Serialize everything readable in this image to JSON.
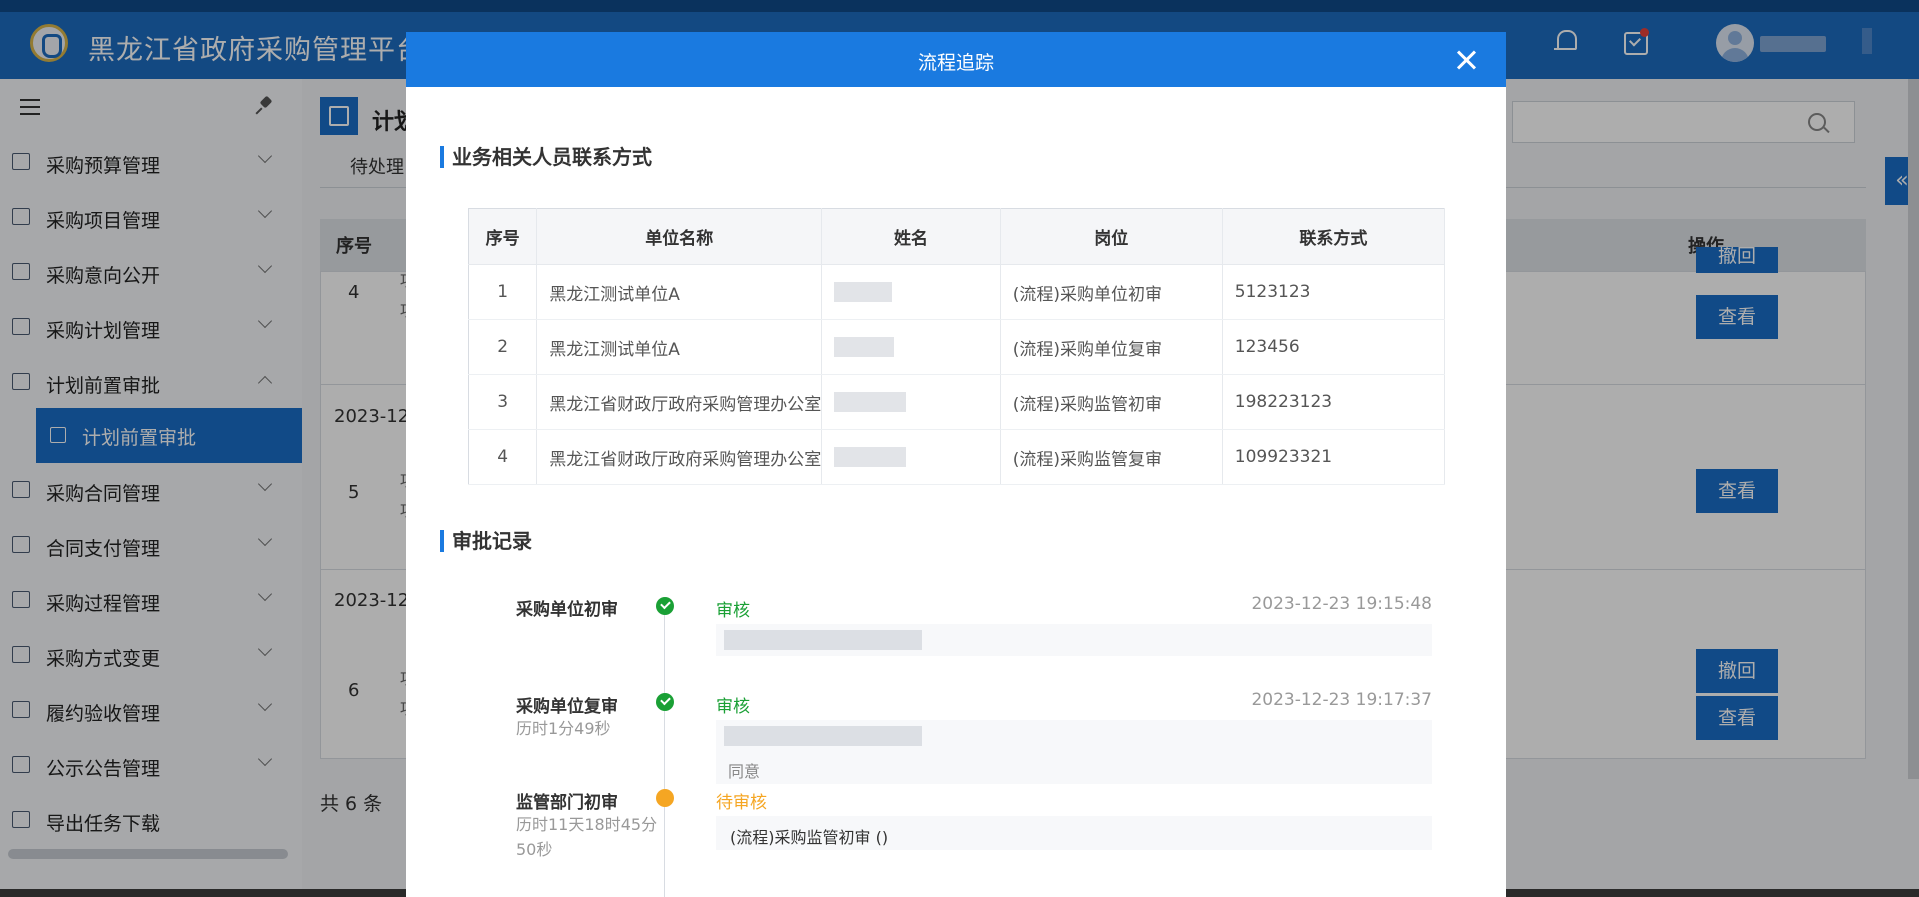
{
  "app": {
    "title": "黑龙江省政府采购管理平台"
  },
  "sidebar": {
    "items": [
      {
        "label": "采购预算管理"
      },
      {
        "label": "采购项目管理"
      },
      {
        "label": "采购意向公开"
      },
      {
        "label": "采购计划管理"
      },
      {
        "label": "计划前置审批"
      },
      {
        "label": "采购合同管理"
      },
      {
        "label": "合同支付管理"
      },
      {
        "label": "采购过程管理"
      },
      {
        "label": "采购方式变更"
      },
      {
        "label": "履约验收管理"
      },
      {
        "label": "公示公告管理"
      },
      {
        "label": "导出任务下载"
      }
    ],
    "active_sub": "计划前置审批"
  },
  "content": {
    "page_title": "计划",
    "tab_pending": "待处理",
    "col_seq": "序号",
    "col_op": "操作",
    "rows": [
      {
        "num": "4",
        "date": "",
        "x1": "项",
        "x2": "项"
      },
      {
        "num": "5",
        "date": "2023-12-",
        "x1": "项",
        "x2": "项"
      },
      {
        "num": "6",
        "date": "2023-12-",
        "x1": "项",
        "x2": "项"
      }
    ],
    "btn_revoke": "撤回",
    "btn_view": "查看",
    "total": "共 6 条"
  },
  "modal": {
    "title": "流程追踪",
    "contacts_title": "业务相关人员联系方式",
    "contacts_headers": [
      "序号",
      "单位名称",
      "姓名",
      "岗位",
      "联系方式"
    ],
    "contacts": [
      {
        "seq": "1",
        "unit": "黑龙江测试单位A",
        "role": "(流程)采购单位初审",
        "phone": "5123123"
      },
      {
        "seq": "2",
        "unit": "黑龙江测试单位A",
        "role": "(流程)采购单位复审",
        "phone": "123456"
      },
      {
        "seq": "3",
        "unit": "黑龙江省财政厅政府采购管理办公室",
        "role": "(流程)采购监管初审",
        "phone": "198223123"
      },
      {
        "seq": "4",
        "unit": "黑龙江省财政厅政府采购管理办公室",
        "role": "(流程)采购监管复审",
        "phone": "109923321"
      }
    ],
    "records_title": "审批记录",
    "records": [
      {
        "stage": "采购单位初审",
        "duration": "",
        "status": "审核",
        "time": "2023-12-23 19:15:48",
        "note": ""
      },
      {
        "stage": "采购单位复审",
        "duration": "历时1分49秒",
        "status": "审核",
        "time": "2023-12-23 19:17:37",
        "note": "同意"
      },
      {
        "stage": "监管部门初审",
        "duration": "历时11天18时45分50秒",
        "status": "待审核",
        "time": "",
        "note": "(流程)采购监管初审 ()"
      }
    ]
  },
  "colors": {
    "brand": "#1d6cc0",
    "modal_header": "#1a7ae0",
    "success": "#1aa035",
    "pending": "#f5a623"
  }
}
